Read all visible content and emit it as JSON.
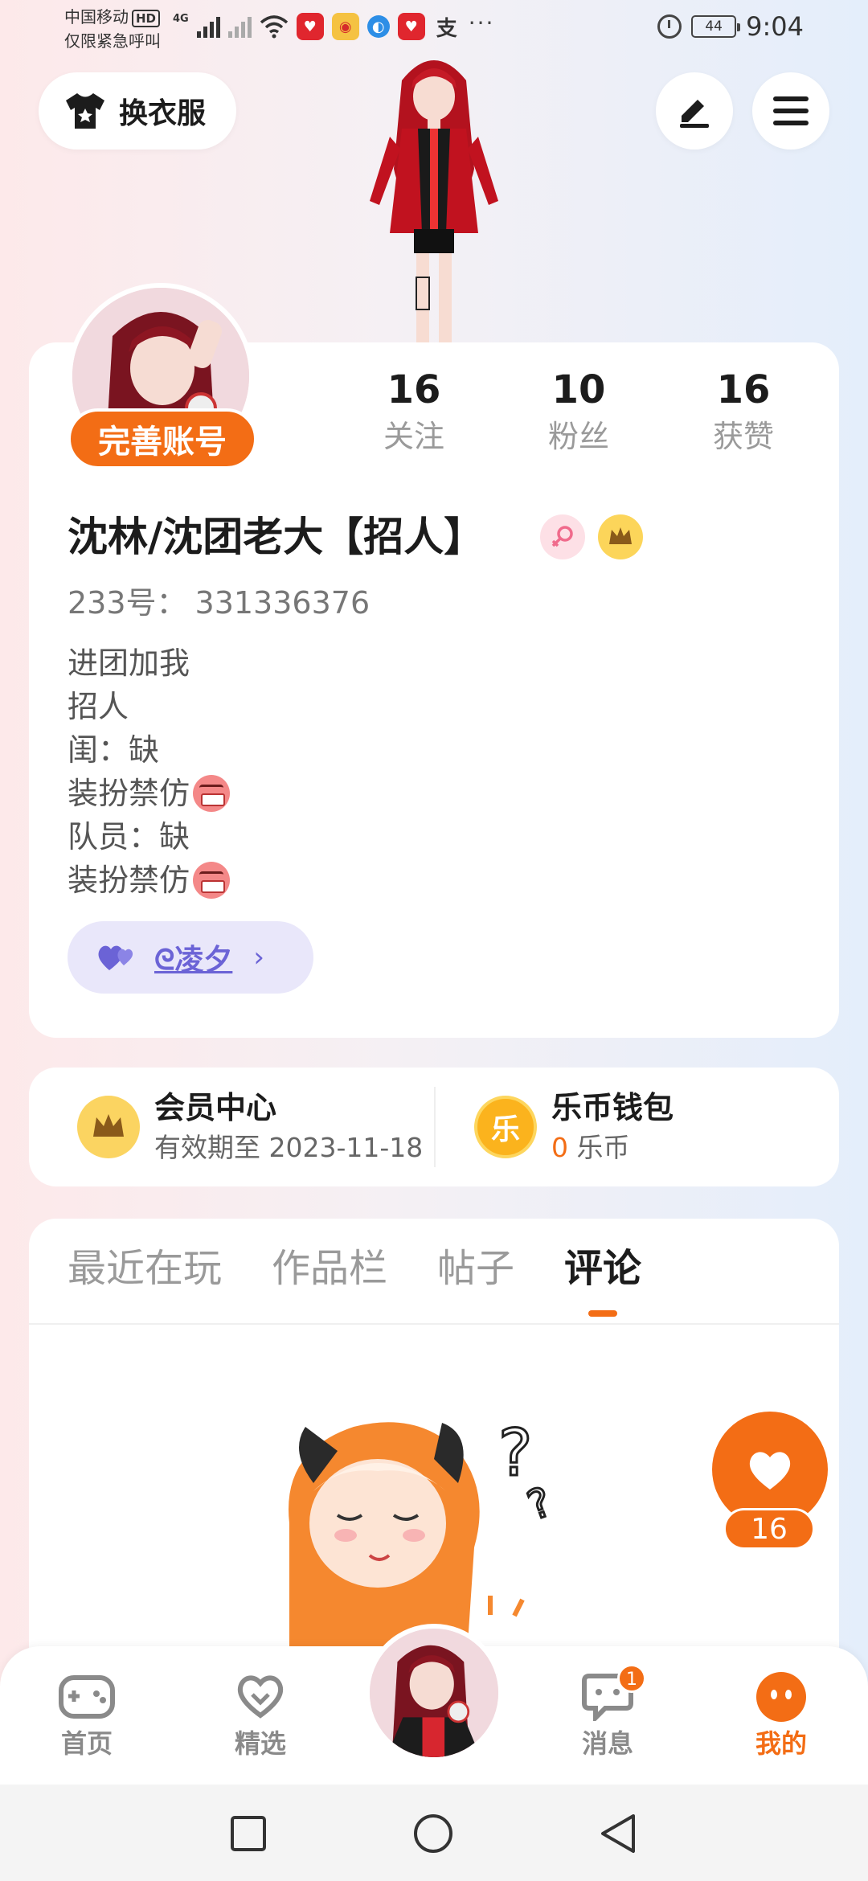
{
  "status_bar": {
    "carrier": "中国移动",
    "hd": "HD",
    "emergency": "仅限紧急呼叫",
    "network": "4G",
    "more": "···",
    "battery": "44",
    "time": "9:04"
  },
  "header": {
    "dress_label": "换衣服",
    "edit_icon": "pencil-icon",
    "menu_icon": "menu-icon"
  },
  "profile": {
    "complete_label": "完善账号",
    "stats": [
      {
        "num": "16",
        "label": "关注"
      },
      {
        "num": "10",
        "label": "粉丝"
      },
      {
        "num": "16",
        "label": "获赞"
      }
    ],
    "username": "沈林/沈团老大【招人】",
    "uid_label": "233号：",
    "uid_value": "331336376",
    "bio": [
      "进团加我",
      "招人",
      "闺：缺",
      "装扮禁仿",
      "队员：缺",
      "装扮禁仿"
    ],
    "partner_name": "ᘓ凌夕",
    "partner_chevron": "›"
  },
  "vip": {
    "title": "会员中心",
    "subtitle": "有效期至 2023-11-18",
    "wallet_title": "乐币钱包",
    "wallet_amount": "0",
    "wallet_unit": " 乐币",
    "coin_char": "乐"
  },
  "tabs": [
    "最近在玩",
    "作品栏",
    "帖子",
    "评论"
  ],
  "like_count": "16",
  "bottom_nav": [
    {
      "label": "首页"
    },
    {
      "label": "精选"
    },
    {
      "label": "消息",
      "badge": "1"
    },
    {
      "label": "我的"
    }
  ],
  "colors": {
    "accent": "#f36d15",
    "partner": "#6b63d6"
  }
}
